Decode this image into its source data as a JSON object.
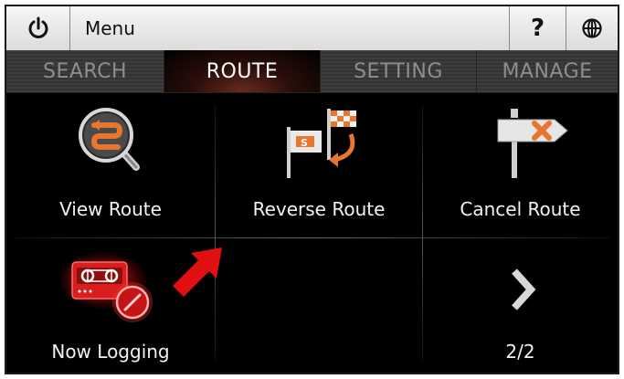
{
  "topbar": {
    "power_icon": "power-icon",
    "menu_label": "Menu",
    "help_label": "?",
    "globe_icon": "globe-icon"
  },
  "tabs": [
    {
      "label": "SEARCH",
      "active": false
    },
    {
      "label": "ROUTE",
      "active": true
    },
    {
      "label": "SETTING",
      "active": false
    },
    {
      "label": "MANAGE",
      "active": false
    }
  ],
  "grid": {
    "view_route": {
      "label": "View Route",
      "icon": "magnifier-route-icon"
    },
    "reverse_route": {
      "label": "Reverse Route",
      "icon": "reverse-flags-icon"
    },
    "cancel_route": {
      "label": "Cancel Route",
      "icon": "cancel-signpost-icon"
    },
    "now_logging": {
      "label": "Now Logging",
      "icon": "recorder-icon"
    },
    "next_page": {
      "label": "2/2",
      "icon": "chevron-right-icon"
    }
  },
  "annotation": {
    "icon": "red-arrow-icon",
    "color": "#e01010"
  },
  "colors": {
    "accent": "#e8762e",
    "active_tab_glow": "#6a2a1e",
    "logging_red": "#d81e1e"
  }
}
